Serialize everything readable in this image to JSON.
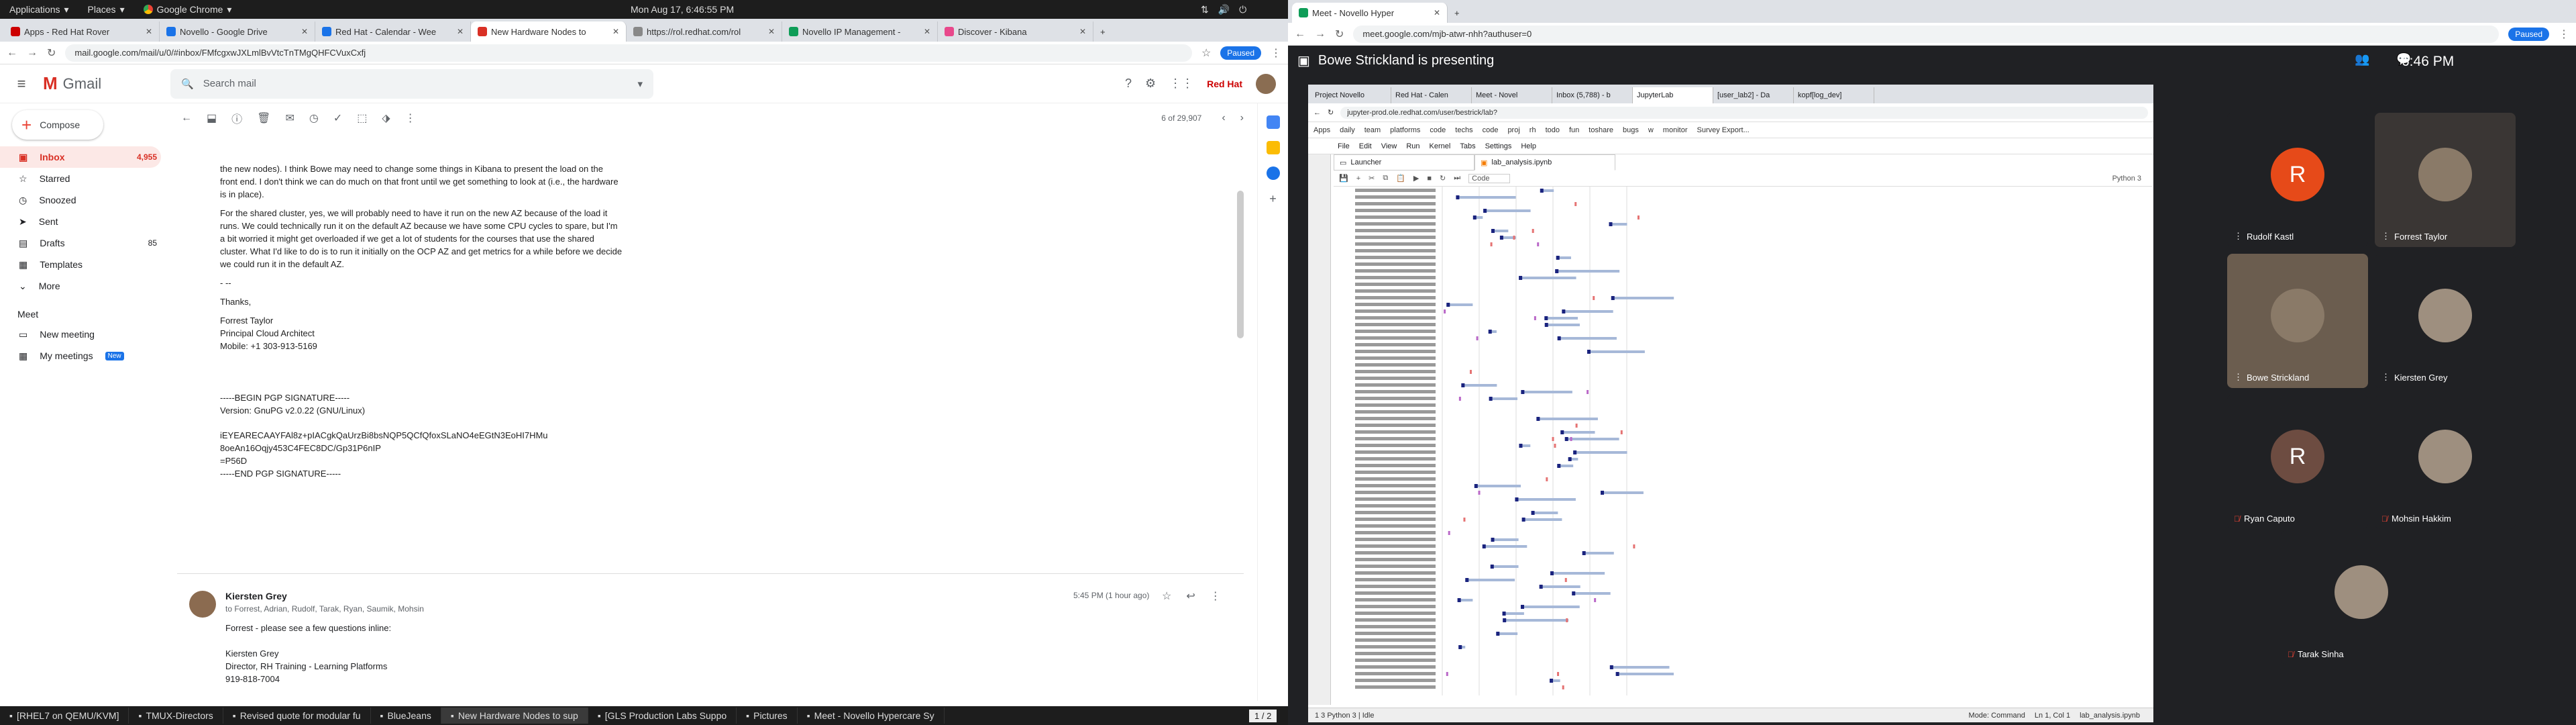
{
  "topbar": {
    "applications": "Applications",
    "places": "Places",
    "chrome": "Google Chrome",
    "clock": "Mon Aug 17,  6:46:55 PM"
  },
  "left_tabs": [
    {
      "label": "Apps - Red Hat Rover",
      "color": "#c00"
    },
    {
      "label": "Novello - Google Drive",
      "color": "#1a73e8"
    },
    {
      "label": "Red Hat - Calendar - Wee",
      "color": "#1a73e8"
    },
    {
      "label": "New Hardware Nodes to",
      "color": "#d93025"
    },
    {
      "label": "https://rol.redhat.com/rol",
      "color": "#888"
    },
    {
      "label": "Novello IP Management -",
      "color": "#0f9d58"
    },
    {
      "label": "Discover - Kibana",
      "color": "#e8488b"
    }
  ],
  "left_url": "mail.google.com/mail/u/0/#inbox/FMfcgxwJXLmlBvVtcTnTMgQHFCVuxCxfj",
  "paused": "Paused",
  "gmail": {
    "logo": "Gmail",
    "search_placeholder": "Search mail",
    "redhat": "Red Hat",
    "compose": "Compose",
    "nav": [
      {
        "label": "Inbox",
        "count": "4,955"
      },
      {
        "label": "Starred",
        "count": ""
      },
      {
        "label": "Snoozed",
        "count": ""
      },
      {
        "label": "Sent",
        "count": ""
      },
      {
        "label": "Drafts",
        "count": "85"
      },
      {
        "label": "Templates",
        "count": ""
      },
      {
        "label": "More",
        "count": ""
      }
    ],
    "meet_header": "Meet",
    "new_meeting": "New meeting",
    "my_meetings": "My meetings",
    "new_badge": "New",
    "pagination": "6 of 29,907",
    "body": [
      "the new nodes).  I think Bowe may need to change some things in Kibana to present the load on the front end.  I don't think we can do much on that front until we get something to look at (i.e., the hardware is in place).",
      "For the shared cluster, yes, we will probably need to have it run on the new AZ because of the load it runs.  We could technically run it on the default AZ because we have some CPU cycles to spare, but I'm a bit worried it might get overloaded if we get a lot of students for the courses that use the shared cluster.  What I'd like to do is to run it initially on the OCP AZ and get metrics for a while before we decide we could run it in the default AZ.",
      "- --",
      "Thanks,",
      "Forrest Taylor",
      "Principal Cloud Architect",
      "Mobile: +1 303-913-5169",
      "-----BEGIN PGP SIGNATURE-----",
      "Version: GnuPG v2.0.22 (GNU/Linux)",
      "iEYEARECAAYFAl8z+pIACgkQaUrzBi8bsNQP5QCfQfoxSLaNO4eEGtN3EoHI7HMu",
      "8oeAn16Oqjy453C4FEC8DC/Gp31P6nIP",
      "=P56D",
      "-----END PGP SIGNATURE-----"
    ],
    "msg2_sender": "Kiersten Grey",
    "msg2_to": "to Forrest, Adrian, Rudolf, Tarak, Ryan, Saumik, Mohsin",
    "msg2_time": "5:45 PM (1 hour ago)",
    "msg2_body": "Forrest - please see a few questions inline:",
    "msg2_sig_name": "Kiersten Grey",
    "msg2_sig_title": "Director, RH Training - Learning Platforms",
    "msg2_sig_phone": "919-818-7004"
  },
  "right_tabs": [
    {
      "label": "Meet - Novello Hyper",
      "color": "#0f9d58"
    }
  ],
  "right_url": "meet.google.com/mjb-atwr-nhh?authuser=0",
  "meet": {
    "presenting": "Bowe Strickland is presenting",
    "clock": "6:46 PM",
    "participants": [
      {
        "name": "Rudolf Kastl",
        "initial": "R",
        "color": "#e64a19",
        "muted": false
      },
      {
        "name": "Forrest Taylor",
        "initial": "",
        "color": "#3a3a3a",
        "muted": false
      },
      {
        "name": "Bowe Strickland",
        "initial": "",
        "color": "#5a5248",
        "muted": false
      },
      {
        "name": "Kiersten Grey",
        "initial": "",
        "color": "#3c4043",
        "muted": false
      },
      {
        "name": "Ryan Caputo",
        "initial": "R",
        "color": "#6d4c41",
        "muted": true
      },
      {
        "name": "Mohsin Hakkim",
        "initial": "",
        "color": "#3c4043",
        "muted": true
      },
      {
        "name": "Tarak Sinha",
        "initial": "",
        "color": "#3c4043",
        "muted": true
      }
    ]
  },
  "shared": {
    "tabs": [
      "Project Novello",
      "Red Hat - Calen",
      "Meet - Novel",
      "Inbox (5,788) - b",
      "JupyterLab",
      "[user_lab2] - Da",
      "kopf[log_dev]"
    ],
    "url": "jupyter-prod.ole.redhat.com/user/bestrick/lab?",
    "bookmarks": [
      "Apps",
      "daily",
      "team",
      "platforms",
      "code",
      "techs",
      "code",
      "proj",
      "rh",
      "todo",
      "fun",
      "toshare",
      "bugs",
      "w",
      "monitor",
      "Survey Export..."
    ],
    "menu": [
      "File",
      "Edit",
      "View",
      "Run",
      "Kernel",
      "Tabs",
      "Settings",
      "Help"
    ],
    "lab_tabs": [
      "Launcher",
      "lab_analysis.ipynb"
    ],
    "cell_type": "Code",
    "kernel": "Python 3",
    "status_left": "1   3   Python 3 | Idle",
    "status_mode": "Mode: Command",
    "status_pos": "Ln 1, Col 1",
    "status_file": "lab_analysis.ipynb"
  },
  "taskbar": [
    {
      "label": "[RHEL7 on QEMU/KVM]"
    },
    {
      "label": "TMUX-Directors"
    },
    {
      "label": "Revised quote for modular fu"
    },
    {
      "label": "BlueJeans"
    },
    {
      "label": "New Hardware Nodes to sup"
    },
    {
      "label": "[GLS Production Labs Suppo"
    },
    {
      "label": "Pictures"
    },
    {
      "label": "Meet - Novello Hypercare Sy"
    }
  ],
  "workspace": "1 / 2"
}
